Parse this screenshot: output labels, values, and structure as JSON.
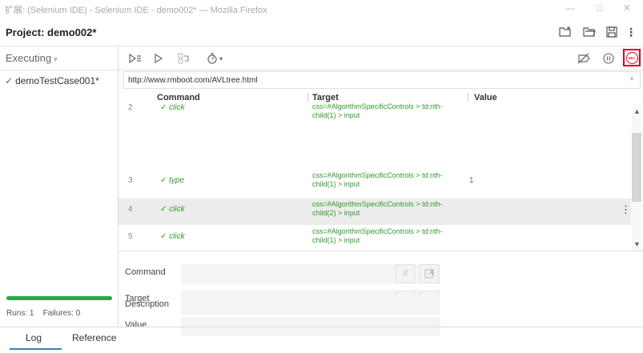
{
  "window": {
    "title": "扩展: (Selenium IDE) - Selenium IDE - demo002* — Mozilla Firefox",
    "minimize_icon": "minimize-icon",
    "maximize_icon": "maximize-icon",
    "close_icon": "close-icon"
  },
  "project": {
    "title": "Project: demo002*",
    "icons": [
      "new-folder-icon",
      "open-project-icon",
      "save-icon",
      "more-vertical-icon"
    ]
  },
  "sidebar": {
    "mode_label": "Executing",
    "test_case": {
      "check": "✓",
      "name": "demoTestCase001*"
    },
    "progress_fraction": 1.0,
    "runs_label": "Runs: 1",
    "failures_label": "Failures: 0",
    "progress_color": "#28a745"
  },
  "toolbar": {
    "icons": [
      "run-all-tests-icon",
      "run-current-test-icon",
      "step-over-icon",
      "speed-timer-icon",
      "disable-breakpoints-icon",
      "pause-icon",
      "record-icon"
    ],
    "record_label": "REC",
    "record_color": "#d9001b"
  },
  "url": {
    "value": "http://www.rmboot.com/AVLtree.html"
  },
  "table": {
    "headers": {
      "command": "Command",
      "target": "Target",
      "value": "Value"
    },
    "rows": [
      {
        "num": "2",
        "command": "✓ click",
        "target": "css=#AlgorithmSpecificControls > td:nth-child(1) > input",
        "value": ""
      },
      {
        "num": "3",
        "command": "✓ type",
        "target": "css=#AlgorithmSpecificControls > td:nth-child(1) > input",
        "value": "1"
      },
      {
        "num": "4",
        "command": "✓ click",
        "target": "css=#AlgorithmSpecificControls > td:nth-child(2) > input",
        "value": "",
        "selected": true
      },
      {
        "num": "5",
        "command": "✓ click",
        "target": "css=#AlgorithmSpecificControls > td:nth-child(1) > input",
        "value": ""
      }
    ]
  },
  "editor": {
    "command_label": "Command",
    "target_label": "Target",
    "value_label": "Value",
    "description_label": "Description",
    "command_value": "",
    "target_value": "",
    "value_value": "",
    "description_value": ""
  },
  "bottom_tabs": {
    "log": "Log",
    "reference": "Reference"
  }
}
